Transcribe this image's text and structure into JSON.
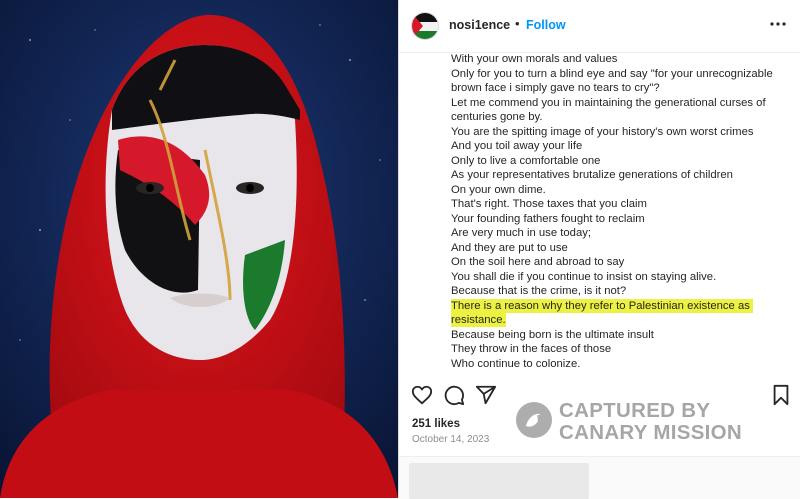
{
  "post": {
    "username": "nosi1ence",
    "separator": "•",
    "follow_label": "Follow",
    "caption_lines": [
      "With your own morals and values",
      "Only for you to turn a blind eye and say \"for your unrecognizable brown face i simply gave no tears to cry\"?",
      "Let me commend you in maintaining the generational curses of centuries gone by.",
      "You are the spitting image of your history's own worst crimes",
      "And you toil away your life",
      "Only to live a comfortable one",
      "As your representatives brutalize generations of children",
      "On your own dime.",
      "That's right. Those taxes that you claim",
      "Your founding fathers fought to reclaim",
      "Are very much in use today;",
      "And they are put to use",
      "On the soil here and abroad to say",
      "You shall die if you continue to insist on staying alive.",
      "Because that is the crime, is it not?"
    ],
    "highlighted_line": "There is a reason why they refer to Palestinian existence as resistance.",
    "caption_lines_after": [
      "Because being born is the ultimate insult",
      "They throw in the faces of those",
      "Who continue to colonize."
    ],
    "likes": "251 likes",
    "date": "October 14, 2023"
  },
  "icons": {
    "more": "more-options-icon",
    "like": "heart-icon",
    "comment": "comment-icon",
    "share": "share-icon",
    "save": "bookmark-icon"
  },
  "watermark": {
    "line1": "CAPTURED BY",
    "line2": "CANARY MISSION"
  },
  "colors": {
    "follow": "#0095f6",
    "highlight": "#ecf142",
    "hijab": "#d8111a",
    "flag_green": "#1c7a2c"
  }
}
